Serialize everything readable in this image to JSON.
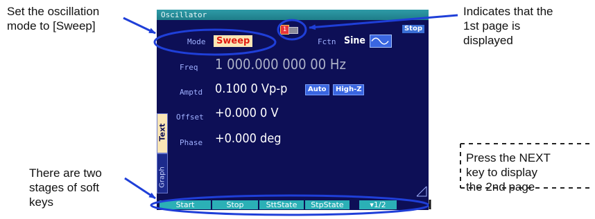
{
  "annotations": {
    "mode": [
      "Set the oscillation",
      "mode to [Sweep]"
    ],
    "page": [
      "Indicates that the",
      "1st page is",
      "displayed"
    ],
    "next": [
      "Press the NEXT",
      "key to display",
      "the 2nd page"
    ],
    "softkeys": [
      "There are two",
      "stages of soft",
      "keys"
    ]
  },
  "screen": {
    "title": "Oscillator",
    "status": "Stop",
    "page_indicator": "1",
    "mode_label": "Mode",
    "mode_value": "Sweep",
    "fctn_label": "Fctn",
    "fctn_value": "Sine",
    "freq_label": "Freq",
    "freq_value": "1 000.000 000 00 Hz",
    "amptd_label": "Amptd",
    "amptd_value": "0.100 0 Vp-p",
    "amptd_auto": "Auto",
    "amptd_highz": "High-Z",
    "offset_label": "Offset",
    "offset_value": "+0.000 0 V",
    "phase_label": "Phase",
    "phase_value": "+0.000 deg",
    "tab_text": "Text",
    "tab_graph": "Graph"
  },
  "softkeys": [
    {
      "label": "Start"
    },
    {
      "label": "Stop"
    },
    {
      "label": "SttState"
    },
    {
      "label": "StpState"
    },
    {
      "label": "▾1/2"
    }
  ],
  "colors": {
    "screen_bg": "#0d0f56",
    "highlight_blue": "#1f3fd8",
    "softkey_teal": "#2bb0b6",
    "sweep_red": "#e01a12"
  }
}
